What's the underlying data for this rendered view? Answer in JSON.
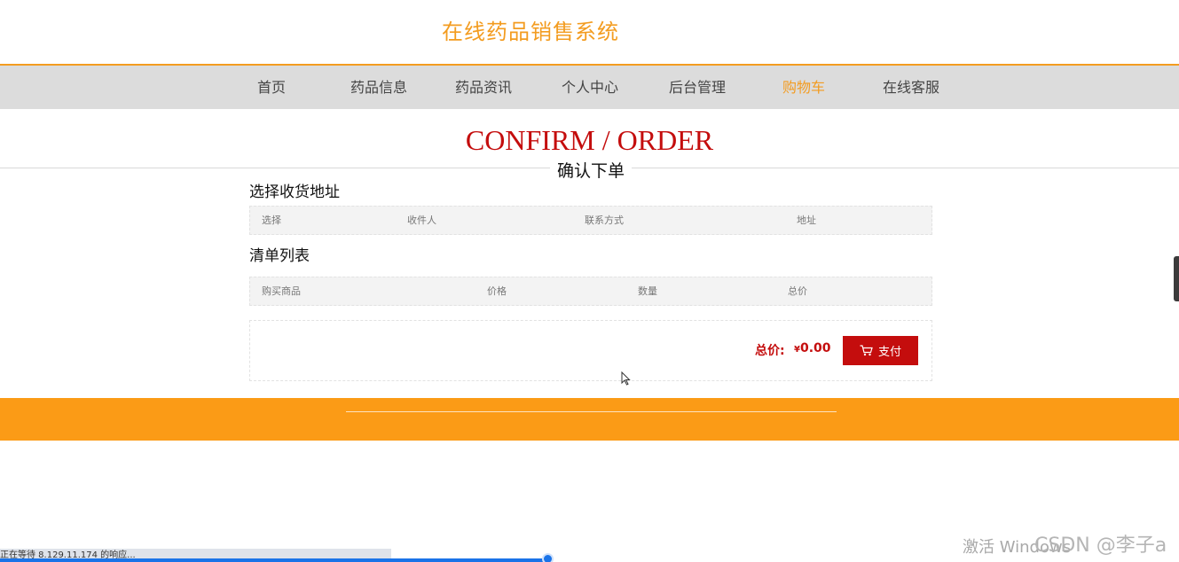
{
  "header": {
    "site_title": "在线药品销售系统"
  },
  "nav": {
    "items": [
      {
        "label": "首页",
        "active": false
      },
      {
        "label": "药品信息",
        "active": false
      },
      {
        "label": "药品资讯",
        "active": false
      },
      {
        "label": "个人中心",
        "active": false
      },
      {
        "label": "后台管理",
        "active": false
      },
      {
        "label": "购物车",
        "active": true
      },
      {
        "label": "在线客服",
        "active": false
      }
    ]
  },
  "section": {
    "title_en": "CONFIRM / ORDER",
    "title_zh": "确认下单"
  },
  "address": {
    "heading": "选择收货地址",
    "columns": [
      "选择",
      "收件人",
      "联系方式",
      "地址"
    ]
  },
  "order_list": {
    "heading": "清单列表",
    "columns": [
      "购买商品",
      "价格",
      "数量",
      "总价"
    ]
  },
  "summary": {
    "total_label": "总价:",
    "currency": "¥",
    "total_value": "0.00",
    "pay_label": "支付"
  },
  "status": {
    "text": "正在等待 8.129.11.174 的响应..."
  },
  "watermarks": {
    "activate": "激活 Windows",
    "csdn": "CSDN @李子a"
  },
  "colors": {
    "accent": "#f39c20",
    "brand_red": "#c40d0d",
    "footer": "#fb9b16",
    "nav_bg": "#dcdcdc"
  }
}
